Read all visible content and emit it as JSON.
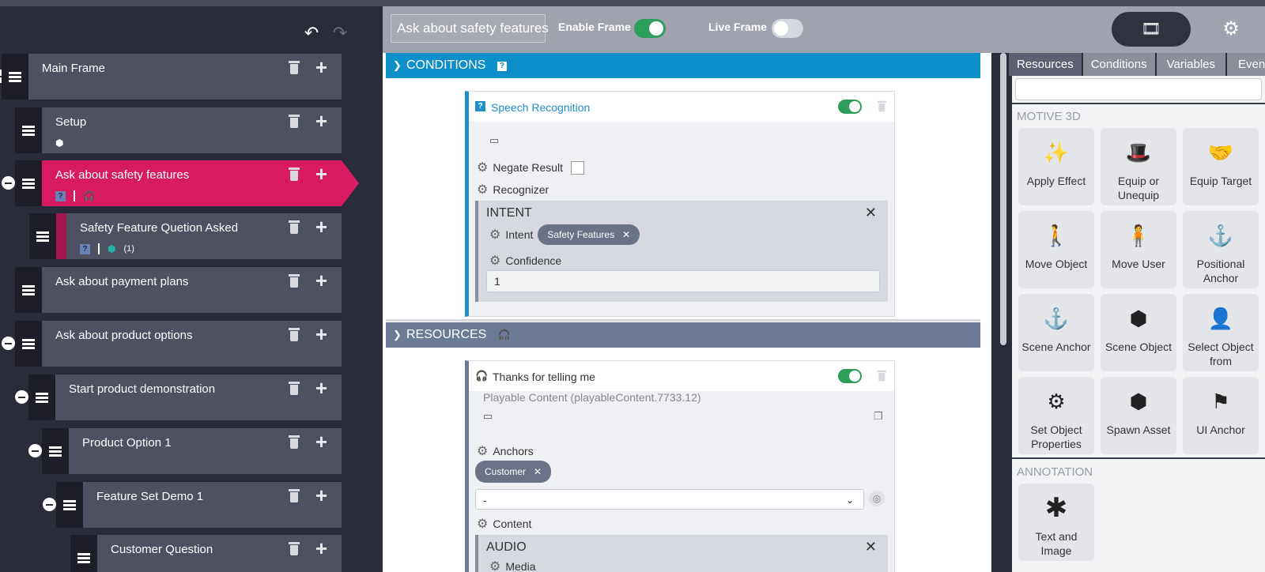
{
  "toolbar": {
    "undo_icon": "undo-icon",
    "redo_icon": "redo-icon"
  },
  "tree": [
    {
      "title": "Main Frame"
    },
    {
      "title": "Setup"
    },
    {
      "title": "Ask about safety features"
    },
    {
      "title": "Safety Feature Quetion Asked",
      "count": "(1)"
    },
    {
      "title": "Ask about payment plans"
    },
    {
      "title": "Ask about product options"
    },
    {
      "title": "Start product demonstration"
    },
    {
      "title": "Product Option 1"
    },
    {
      "title": "Feature Set Demo 1"
    },
    {
      "title": "Customer Question"
    }
  ],
  "header": {
    "frame_title": "Ask about safety features",
    "enable_frame_label": "Enable Frame",
    "enable_frame_on": true,
    "live_frame_label": "Live Frame",
    "live_frame_on": false
  },
  "conditions": {
    "section_label": "CONDITIONS",
    "card_title": "Speech Recognition",
    "negate_label": "Negate Result",
    "recognizer_label": "Recognizer",
    "intent_header": "INTENT",
    "intent_label": "Intent",
    "intent_chip": "Safety Features",
    "confidence_label": "Confidence",
    "confidence_value": "1"
  },
  "resources": {
    "section_label": "RESOURCES",
    "card_title": "Thanks for telling me",
    "subtitle": "Playable Content (playableContent.7733.12)",
    "anchors_label": "Anchors",
    "anchor_chip": "Customer",
    "select_value": "-",
    "content_label": "Content",
    "audio_header": "AUDIO",
    "media_label": "Media"
  },
  "right": {
    "tabs": [
      "Resources",
      "Conditions",
      "Variables",
      "Events"
    ],
    "section1": "MOTIVE 3D",
    "tiles": [
      {
        "label": "Apply Effect",
        "icon": "magic-wand-icon"
      },
      {
        "label": "Equip or Unequip",
        "icon": "hat-icon"
      },
      {
        "label": "Equip Target",
        "icon": "handshake-icon"
      },
      {
        "label": "Move Object",
        "icon": "person-dolly-icon"
      },
      {
        "label": "Move User",
        "icon": "person-board-icon"
      },
      {
        "label": "Positional Anchor",
        "icon": "anchor-icon"
      },
      {
        "label": "Scene Anchor",
        "icon": "anchor-icon"
      },
      {
        "label": "Scene Object",
        "icon": "cube-icon"
      },
      {
        "label": "Select Object from",
        "icon": "user-check-icon"
      },
      {
        "label": "Set Object Properties",
        "icon": "gears-icon"
      },
      {
        "label": "Spawn Asset",
        "icon": "cube-icon"
      },
      {
        "label": "UI Anchor",
        "icon": "sign-icon"
      }
    ],
    "section2": "ANNOTATION",
    "annotation_tile": {
      "label": "Text and Image",
      "icon": "asterisk-icon"
    }
  }
}
